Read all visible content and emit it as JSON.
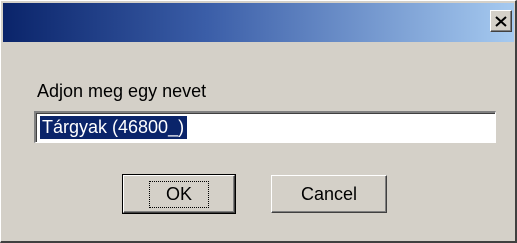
{
  "window": {
    "title": ""
  },
  "prompt": {
    "label": "Adjon meg egy nevet"
  },
  "name_field": {
    "value": "Tárgyak (46800_)"
  },
  "buttons": {
    "ok_label": "OK",
    "cancel_label": "Cancel"
  },
  "icons": {
    "close": "close-icon"
  },
  "colors": {
    "titlebar_start": "#0a246a",
    "titlebar_end": "#a6caf0",
    "dialog_face": "#d4d0c8",
    "selection": "#0a246a"
  }
}
